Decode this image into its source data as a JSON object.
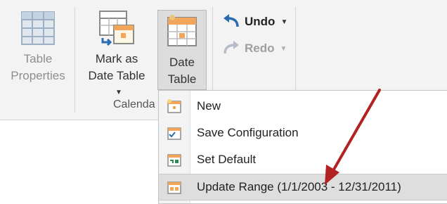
{
  "ribbon": {
    "table_properties": {
      "label_line1": "Table",
      "label_line2": "Properties",
      "icon": "table-grid-icon"
    },
    "mark_as_date_table": {
      "label_line1": "Mark as",
      "label_line2": "Date Table",
      "icon": "calendar-mark-icon"
    },
    "date_table": {
      "label_line1": "Date",
      "label_line2": "Table",
      "icon": "calendar-table-icon"
    },
    "undo": {
      "label": "Undo",
      "icon": "undo-icon"
    },
    "redo": {
      "label": "Redo",
      "icon": "redo-icon"
    },
    "group_label": "Calenda"
  },
  "menu": {
    "items": [
      {
        "label": "New",
        "icon": "new-calendar-icon"
      },
      {
        "label": "Save Configuration",
        "icon": "save-config-icon"
      },
      {
        "label": "Set Default",
        "icon": "set-default-icon"
      },
      {
        "label": "Update Range (1/1/2003 - 12/31/2011)",
        "icon": "update-range-icon",
        "highlighted": true
      }
    ]
  },
  "colors": {
    "ribbon_bg": "#f3f3f3",
    "accent_blue": "#2b6cb0",
    "arrow_red": "#b22222",
    "highlight": "#dedede"
  }
}
